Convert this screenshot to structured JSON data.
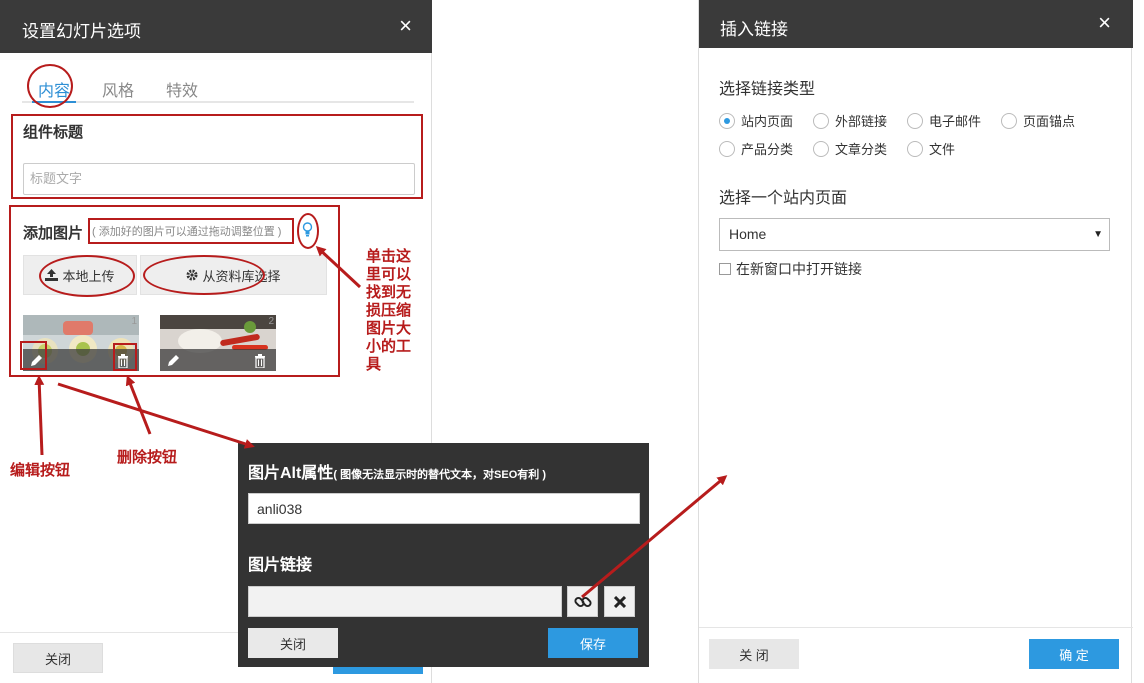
{
  "left_dialog": {
    "title": "设置幻灯片选项",
    "close_glyph": "×",
    "tabs": [
      {
        "label": "内容",
        "active": true
      },
      {
        "label": "风格",
        "active": false
      },
      {
        "label": "特效",
        "active": false
      }
    ],
    "component_title_label": "组件标题",
    "title_placeholder": "标题文字",
    "add_image_label": "添加图片",
    "add_image_hint": "( 添加好的图片可以通过拖动调整位置 )",
    "upload_local_label": "本地上传",
    "choose_library_label": "从资料库选择",
    "images": [
      {
        "index": "1"
      },
      {
        "index": "2"
      }
    ],
    "close_button": "关闭"
  },
  "annotations": {
    "tool_tip": "单击这里可以找到无损压缩图片大小的工具",
    "edit_button_note": "编辑按钮",
    "delete_button_note": "删除按钮",
    "color": "#b71c1c"
  },
  "image_popup": {
    "alt_label": "图片Alt属性",
    "alt_note": "( 图像无法显示时的替代文本，对SEO有利 )",
    "alt_value": "anli038",
    "link_label": "图片链接",
    "link_value": "",
    "close_button": "关闭",
    "save_button": "保存"
  },
  "insert_link_dialog": {
    "title": "插入链接",
    "close_glyph": "×",
    "link_type_label": "选择链接类型",
    "link_types": [
      {
        "label": "站内页面",
        "selected": true
      },
      {
        "label": "外部链接",
        "selected": false
      },
      {
        "label": "电子邮件",
        "selected": false
      },
      {
        "label": "页面锚点",
        "selected": false
      },
      {
        "label": "产品分类",
        "selected": false
      },
      {
        "label": "文章分类",
        "selected": false
      },
      {
        "label": "文件",
        "selected": false
      }
    ],
    "page_select_label": "选择一个站内页面",
    "page_select_value": "Home",
    "new_window_label": "在新窗口中打开链接",
    "new_window_checked": false,
    "close_button": "关 闭",
    "ok_button": "确 定"
  },
  "colors": {
    "header_dark": "#3a3a3a",
    "accent_blue": "#2d99e0",
    "annotation_red": "#b71c1c"
  }
}
